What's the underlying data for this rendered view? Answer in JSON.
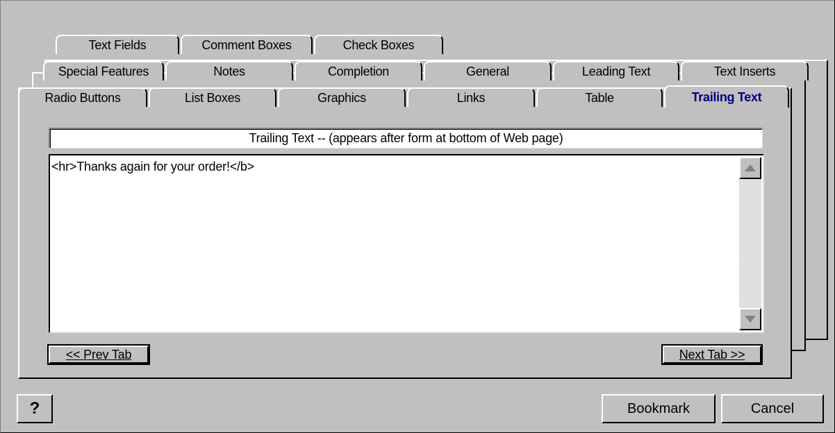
{
  "tabs_row1": [
    {
      "label": "Text Fields"
    },
    {
      "label": "Comment Boxes"
    },
    {
      "label": "Check Boxes"
    }
  ],
  "tabs_row2": [
    {
      "label": "Special Features"
    },
    {
      "label": "Notes"
    },
    {
      "label": "Completion"
    },
    {
      "label": "General"
    },
    {
      "label": "Leading Text"
    },
    {
      "label": "Text Inserts"
    }
  ],
  "tabs_row3": [
    {
      "label": "Radio Buttons"
    },
    {
      "label": "List Boxes"
    },
    {
      "label": "Graphics"
    },
    {
      "label": "Links"
    },
    {
      "label": "Table"
    },
    {
      "label": "Trailing Text",
      "active": true
    }
  ],
  "panel": {
    "field_title": "Trailing Text -- (appears after form at bottom of Web page)",
    "field_value": "<hr>Thanks again for your order!</b>",
    "prev_label": "<< Prev Tab",
    "next_label": "Next Tab >>"
  },
  "footer": {
    "help_label": "?",
    "bookmark_label": "Bookmark",
    "cancel_label": "Cancel"
  },
  "colors": {
    "background": "#c0c0c0",
    "active_tab_text": "#000080"
  }
}
